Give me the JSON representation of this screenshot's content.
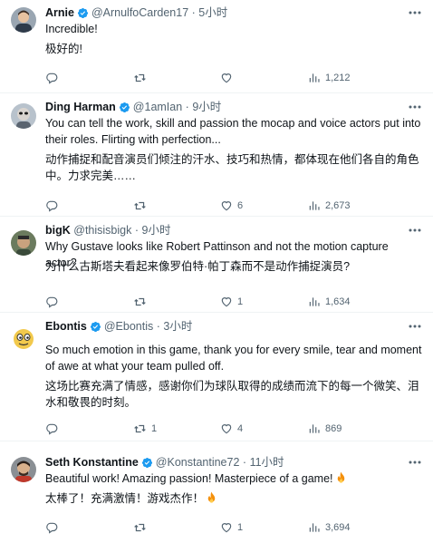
{
  "tweets": [
    {
      "name": "Arnie",
      "handle": "@ArnulfoCarden17",
      "separator": "·",
      "time": "5小时",
      "text_en": "Incredible!",
      "text_zh": "极好的!",
      "replies": "",
      "retweets": "",
      "likes": "",
      "views": "1,212"
    },
    {
      "name": "Ding Harman",
      "handle": "@1amIan",
      "separator": "·",
      "time": "9小时",
      "text_en": "You can tell the work, skill and passion the mocap and voice actors put into their roles. Flirting with perfection...",
      "text_zh": "动作捕捉和配音演员们倾注的汗水、技巧和热情，都体现在他们各自的角色中。力求完美……",
      "replies": "",
      "retweets": "",
      "likes": "6",
      "views": "2,673"
    },
    {
      "name": "bigK",
      "handle": "@thisisbigk",
      "separator": "·",
      "time": "9小时",
      "text_en": "Why Gustave looks like Robert Pattinson and not the motion capture actor?",
      "text_zh": "为什么古斯塔夫看起来像罗伯特·帕丁森而不是动作捕捉演员?",
      "replies": "",
      "retweets": "",
      "likes": "1",
      "views": "1,634"
    },
    {
      "name": "Ebontis",
      "handle": "@Ebontis",
      "separator": "·",
      "time": "3小时",
      "text_en": "So much emotion in this game, thank you for every smile, tear and moment of awe at what your team pulled off.",
      "text_zh": "这场比赛充满了情感，感谢你们为球队取得的成绩而流下的每一个微笑、泪水和敬畏的时刻。",
      "replies": "",
      "retweets": "1",
      "likes": "4",
      "views": "869"
    },
    {
      "name": "Seth Konstantine",
      "handle": "@Konstantine72",
      "separator": "·",
      "time": "11小时",
      "text_en": "Beautiful work! Amazing passion! Masterpiece of a game!",
      "text_zh": "太棒了！充满激情！游戏杰作！",
      "replies": "",
      "retweets": "",
      "likes": "1",
      "views": "3,694"
    }
  ],
  "icons": {
    "verified": "verified-badge-icon",
    "more": "more-options-icon",
    "reply": "reply-icon",
    "retweet": "retweet-icon",
    "like": "like-icon",
    "views": "views-icon",
    "fire": "fire-emoji-icon"
  },
  "colors": {
    "verified": "#1d9bf0",
    "secondary_text": "#536471",
    "divider": "#eff3f4",
    "fire": "#f4900c"
  }
}
